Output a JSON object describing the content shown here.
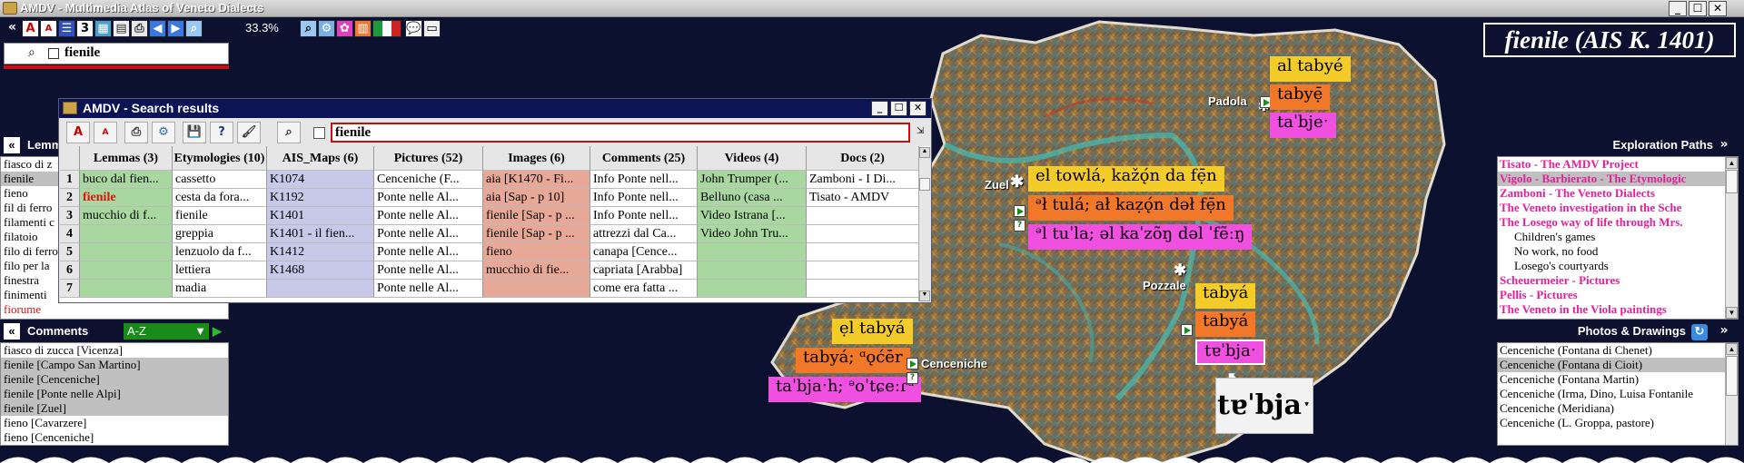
{
  "window": {
    "title": "AMDV - Multimedia Atlas of Veneto Dialects"
  },
  "toolbar": {
    "zoom": "33.3%",
    "search_value": "fienile"
  },
  "map": {
    "title": "fienile (AIS K. 1401)",
    "places": [
      "Padola",
      "Zuel",
      "Pozzale",
      "Cenceniche"
    ],
    "padola_forms": [
      "al tabyé",
      "tabyẹ̄",
      "taˈbjeˑ"
    ],
    "zuel_forms": [
      "el towlá, kažǫ́n da fẹ̄n",
      "ᵊł tulá; ał kaẓǫ́n dəł fẹ̄n",
      "ᵊl tuˈla; əl kaˈzõŋ dəl ˈfẽːŋ"
    ],
    "pozzale_forms": [
      "tabyá",
      "tabyá",
      "tɐˈbjaˑ"
    ],
    "cenceniche_forms": [
      "ẹl tabyá",
      "tabyá; ᵅǫćēr",
      "taˈbjaˑh; ᵊoˈtɕeːɾᵘ"
    ],
    "big_ipa": "tɐˈbjaˑ"
  },
  "search_window": {
    "title": "AMDV - Search results",
    "input_value": "fienile",
    "columns": [
      "Lemmas (3)",
      "Etymologies (10)",
      "AIS_Maps (6)",
      "Pictures (52)",
      "Images (6)",
      "Comments (25)",
      "Videos (4)",
      "Docs (2)"
    ],
    "rows": [
      [
        "1",
        "buco dal fien...",
        "cassetto",
        "K1074",
        "Cenceniche (F...",
        "aia [K1470 - Fi...",
        "Info Ponte nell...",
        "John Trumper (...",
        "Zamboni - I Di..."
      ],
      [
        "2",
        "fienile",
        "cesta da fora...",
        "K1192",
        "Ponte nelle Al...",
        "aia [Sap - p 10]",
        "Info Ponte nell...",
        "Belluno (casa ...",
        "Tisato - AMDV"
      ],
      [
        "3",
        "mucchio di f...",
        "fienile",
        "K1401",
        "Ponte nelle Al...",
        "fienile [Sap - p ...",
        "Info Ponte nell...",
        "Video Istrana [...",
        ""
      ],
      [
        "4",
        "",
        "greppia",
        "K1401 - il fien...",
        "Ponte nelle Al...",
        "fienile [Sap - p ...",
        "attrezzi dal Ca...",
        "Video John Tru...",
        ""
      ],
      [
        "5",
        "",
        "lenzuolo da f...",
        "K1412",
        "Ponte nelle Al...",
        "fieno",
        "canapa [Cence...",
        "",
        ""
      ],
      [
        "6",
        "",
        "lettiera",
        "K1468",
        "Ponte nelle Al...",
        "mucchio di fie...",
        "capriata [Arabba]",
        "",
        ""
      ],
      [
        "7",
        "",
        "madia",
        "",
        "Ponte nelle Al...",
        "",
        "come era fatta ...",
        "",
        ""
      ]
    ]
  },
  "lemmas_panel": {
    "header": "Lemm",
    "items": [
      "fiasco di z",
      "fienile",
      "fieno",
      "fil di ferro",
      "filamenti c",
      "filatoio",
      "filo di ferro",
      "filo per la",
      "finestra",
      "finimenti",
      "fiorume"
    ]
  },
  "comments_panel": {
    "header": "Comments",
    "sort": "A-Z",
    "items": [
      "fiasco di zucca [Vicenza]",
      "fienile [Campo San Martino]",
      "fienile [Cenceniche]",
      "fienile [Ponte nelle Alpi]",
      "fienile [Zuel]",
      "fieno [Cavarzere]",
      "fieno [Cenceniche]"
    ]
  },
  "exploration_panel": {
    "header": "Exploration Paths",
    "items": [
      {
        "text": "Tisato - The AMDV Project",
        "sub": false
      },
      {
        "text": "Vigolo - Barbierato - The Etymologic",
        "sub": false
      },
      {
        "text": "Zamboni - The Veneto Dialects",
        "sub": false
      },
      {
        "text": "The Veneto investigation in the Sche",
        "sub": false
      },
      {
        "text": "The Losego way of life through Mrs.",
        "sub": false
      },
      {
        "text": "Children's games",
        "sub": true
      },
      {
        "text": "No work, no food",
        "sub": true
      },
      {
        "text": "Losego's courtyards",
        "sub": true
      },
      {
        "text": "Scheuermeier - Pictures",
        "sub": false
      },
      {
        "text": "Pellis - Pictures",
        "sub": false
      },
      {
        "text": "The Veneto in the Viola paintings",
        "sub": false
      }
    ]
  },
  "photos_panel": {
    "header": "Photos & Drawings",
    "items": [
      "Cenceniche (Fontana di Chenet)",
      "Cenceniche (Fontana di Cioit)",
      "Cenceniche (Fontana Martin)",
      "Cenceniche (Irma, Dino, Luisa Fontanile",
      "Cenceniche (Meridiana)",
      "Cenceniche (L. Groppa, pastore)"
    ]
  }
}
